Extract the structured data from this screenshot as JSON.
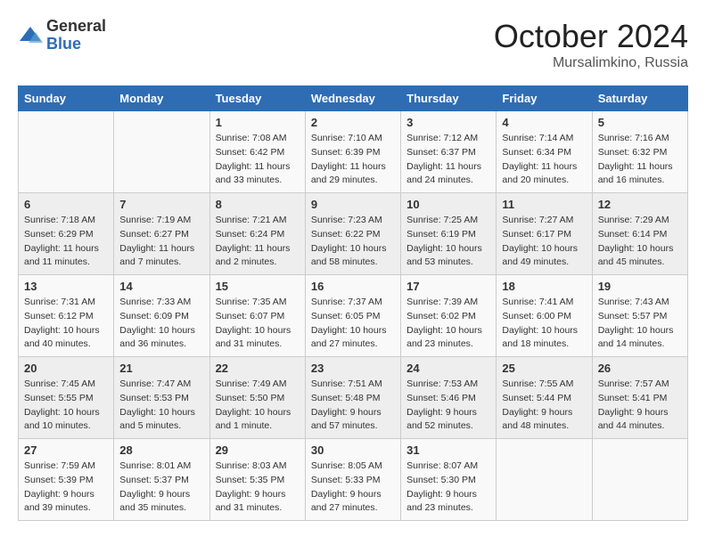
{
  "logo": {
    "general": "General",
    "blue": "Blue"
  },
  "title": "October 2024",
  "location": "Mursalimkino, Russia",
  "days_header": [
    "Sunday",
    "Monday",
    "Tuesday",
    "Wednesday",
    "Thursday",
    "Friday",
    "Saturday"
  ],
  "weeks": [
    [
      {
        "num": "",
        "sunrise": "",
        "sunset": "",
        "daylight": ""
      },
      {
        "num": "",
        "sunrise": "",
        "sunset": "",
        "daylight": ""
      },
      {
        "num": "1",
        "sunrise": "Sunrise: 7:08 AM",
        "sunset": "Sunset: 6:42 PM",
        "daylight": "Daylight: 11 hours and 33 minutes."
      },
      {
        "num": "2",
        "sunrise": "Sunrise: 7:10 AM",
        "sunset": "Sunset: 6:39 PM",
        "daylight": "Daylight: 11 hours and 29 minutes."
      },
      {
        "num": "3",
        "sunrise": "Sunrise: 7:12 AM",
        "sunset": "Sunset: 6:37 PM",
        "daylight": "Daylight: 11 hours and 24 minutes."
      },
      {
        "num": "4",
        "sunrise": "Sunrise: 7:14 AM",
        "sunset": "Sunset: 6:34 PM",
        "daylight": "Daylight: 11 hours and 20 minutes."
      },
      {
        "num": "5",
        "sunrise": "Sunrise: 7:16 AM",
        "sunset": "Sunset: 6:32 PM",
        "daylight": "Daylight: 11 hours and 16 minutes."
      }
    ],
    [
      {
        "num": "6",
        "sunrise": "Sunrise: 7:18 AM",
        "sunset": "Sunset: 6:29 PM",
        "daylight": "Daylight: 11 hours and 11 minutes."
      },
      {
        "num": "7",
        "sunrise": "Sunrise: 7:19 AM",
        "sunset": "Sunset: 6:27 PM",
        "daylight": "Daylight: 11 hours and 7 minutes."
      },
      {
        "num": "8",
        "sunrise": "Sunrise: 7:21 AM",
        "sunset": "Sunset: 6:24 PM",
        "daylight": "Daylight: 11 hours and 2 minutes."
      },
      {
        "num": "9",
        "sunrise": "Sunrise: 7:23 AM",
        "sunset": "Sunset: 6:22 PM",
        "daylight": "Daylight: 10 hours and 58 minutes."
      },
      {
        "num": "10",
        "sunrise": "Sunrise: 7:25 AM",
        "sunset": "Sunset: 6:19 PM",
        "daylight": "Daylight: 10 hours and 53 minutes."
      },
      {
        "num": "11",
        "sunrise": "Sunrise: 7:27 AM",
        "sunset": "Sunset: 6:17 PM",
        "daylight": "Daylight: 10 hours and 49 minutes."
      },
      {
        "num": "12",
        "sunrise": "Sunrise: 7:29 AM",
        "sunset": "Sunset: 6:14 PM",
        "daylight": "Daylight: 10 hours and 45 minutes."
      }
    ],
    [
      {
        "num": "13",
        "sunrise": "Sunrise: 7:31 AM",
        "sunset": "Sunset: 6:12 PM",
        "daylight": "Daylight: 10 hours and 40 minutes."
      },
      {
        "num": "14",
        "sunrise": "Sunrise: 7:33 AM",
        "sunset": "Sunset: 6:09 PM",
        "daylight": "Daylight: 10 hours and 36 minutes."
      },
      {
        "num": "15",
        "sunrise": "Sunrise: 7:35 AM",
        "sunset": "Sunset: 6:07 PM",
        "daylight": "Daylight: 10 hours and 31 minutes."
      },
      {
        "num": "16",
        "sunrise": "Sunrise: 7:37 AM",
        "sunset": "Sunset: 6:05 PM",
        "daylight": "Daylight: 10 hours and 27 minutes."
      },
      {
        "num": "17",
        "sunrise": "Sunrise: 7:39 AM",
        "sunset": "Sunset: 6:02 PM",
        "daylight": "Daylight: 10 hours and 23 minutes."
      },
      {
        "num": "18",
        "sunrise": "Sunrise: 7:41 AM",
        "sunset": "Sunset: 6:00 PM",
        "daylight": "Daylight: 10 hours and 18 minutes."
      },
      {
        "num": "19",
        "sunrise": "Sunrise: 7:43 AM",
        "sunset": "Sunset: 5:57 PM",
        "daylight": "Daylight: 10 hours and 14 minutes."
      }
    ],
    [
      {
        "num": "20",
        "sunrise": "Sunrise: 7:45 AM",
        "sunset": "Sunset: 5:55 PM",
        "daylight": "Daylight: 10 hours and 10 minutes."
      },
      {
        "num": "21",
        "sunrise": "Sunrise: 7:47 AM",
        "sunset": "Sunset: 5:53 PM",
        "daylight": "Daylight: 10 hours and 5 minutes."
      },
      {
        "num": "22",
        "sunrise": "Sunrise: 7:49 AM",
        "sunset": "Sunset: 5:50 PM",
        "daylight": "Daylight: 10 hours and 1 minute."
      },
      {
        "num": "23",
        "sunrise": "Sunrise: 7:51 AM",
        "sunset": "Sunset: 5:48 PM",
        "daylight": "Daylight: 9 hours and 57 minutes."
      },
      {
        "num": "24",
        "sunrise": "Sunrise: 7:53 AM",
        "sunset": "Sunset: 5:46 PM",
        "daylight": "Daylight: 9 hours and 52 minutes."
      },
      {
        "num": "25",
        "sunrise": "Sunrise: 7:55 AM",
        "sunset": "Sunset: 5:44 PM",
        "daylight": "Daylight: 9 hours and 48 minutes."
      },
      {
        "num": "26",
        "sunrise": "Sunrise: 7:57 AM",
        "sunset": "Sunset: 5:41 PM",
        "daylight": "Daylight: 9 hours and 44 minutes."
      }
    ],
    [
      {
        "num": "27",
        "sunrise": "Sunrise: 7:59 AM",
        "sunset": "Sunset: 5:39 PM",
        "daylight": "Daylight: 9 hours and 39 minutes."
      },
      {
        "num": "28",
        "sunrise": "Sunrise: 8:01 AM",
        "sunset": "Sunset: 5:37 PM",
        "daylight": "Daylight: 9 hours and 35 minutes."
      },
      {
        "num": "29",
        "sunrise": "Sunrise: 8:03 AM",
        "sunset": "Sunset: 5:35 PM",
        "daylight": "Daylight: 9 hours and 31 minutes."
      },
      {
        "num": "30",
        "sunrise": "Sunrise: 8:05 AM",
        "sunset": "Sunset: 5:33 PM",
        "daylight": "Daylight: 9 hours and 27 minutes."
      },
      {
        "num": "31",
        "sunrise": "Sunrise: 8:07 AM",
        "sunset": "Sunset: 5:30 PM",
        "daylight": "Daylight: 9 hours and 23 minutes."
      },
      {
        "num": "",
        "sunrise": "",
        "sunset": "",
        "daylight": ""
      },
      {
        "num": "",
        "sunrise": "",
        "sunset": "",
        "daylight": ""
      }
    ]
  ]
}
